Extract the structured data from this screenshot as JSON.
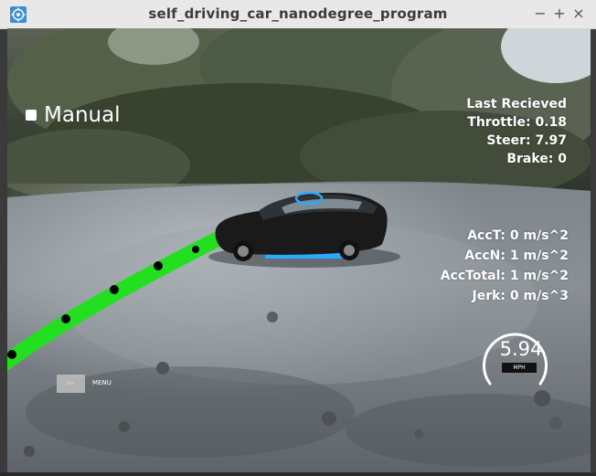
{
  "window": {
    "title": "self_driving_car_nanodegree_program",
    "controls": {
      "minimize": "−",
      "maximize": "+",
      "close": "×"
    }
  },
  "hud": {
    "manual_label": "Manual",
    "manual_checked": false,
    "telemetry": {
      "header": "Last Recieved",
      "throttle": "Throttle: 0.18",
      "steer": "Steer: 7.97",
      "brake": "Brake: 0"
    },
    "acceleration": {
      "acc_t": "AccT: 0 m/s^2",
      "acc_n": "AccN: 1 m/s^2",
      "acc_total": "AccTotal: 1 m/s^2",
      "jerk": "Jerk: 0 m/s^3"
    },
    "speedometer": {
      "value": "5.94",
      "unit": "MPH"
    },
    "esc_key": "esc",
    "menu_label": "MENU"
  },
  "colors": {
    "path_line": "#22e01f",
    "waypoint": "#000000",
    "car_body": "#1a1a1a",
    "car_trim": "#2aa9ff"
  }
}
